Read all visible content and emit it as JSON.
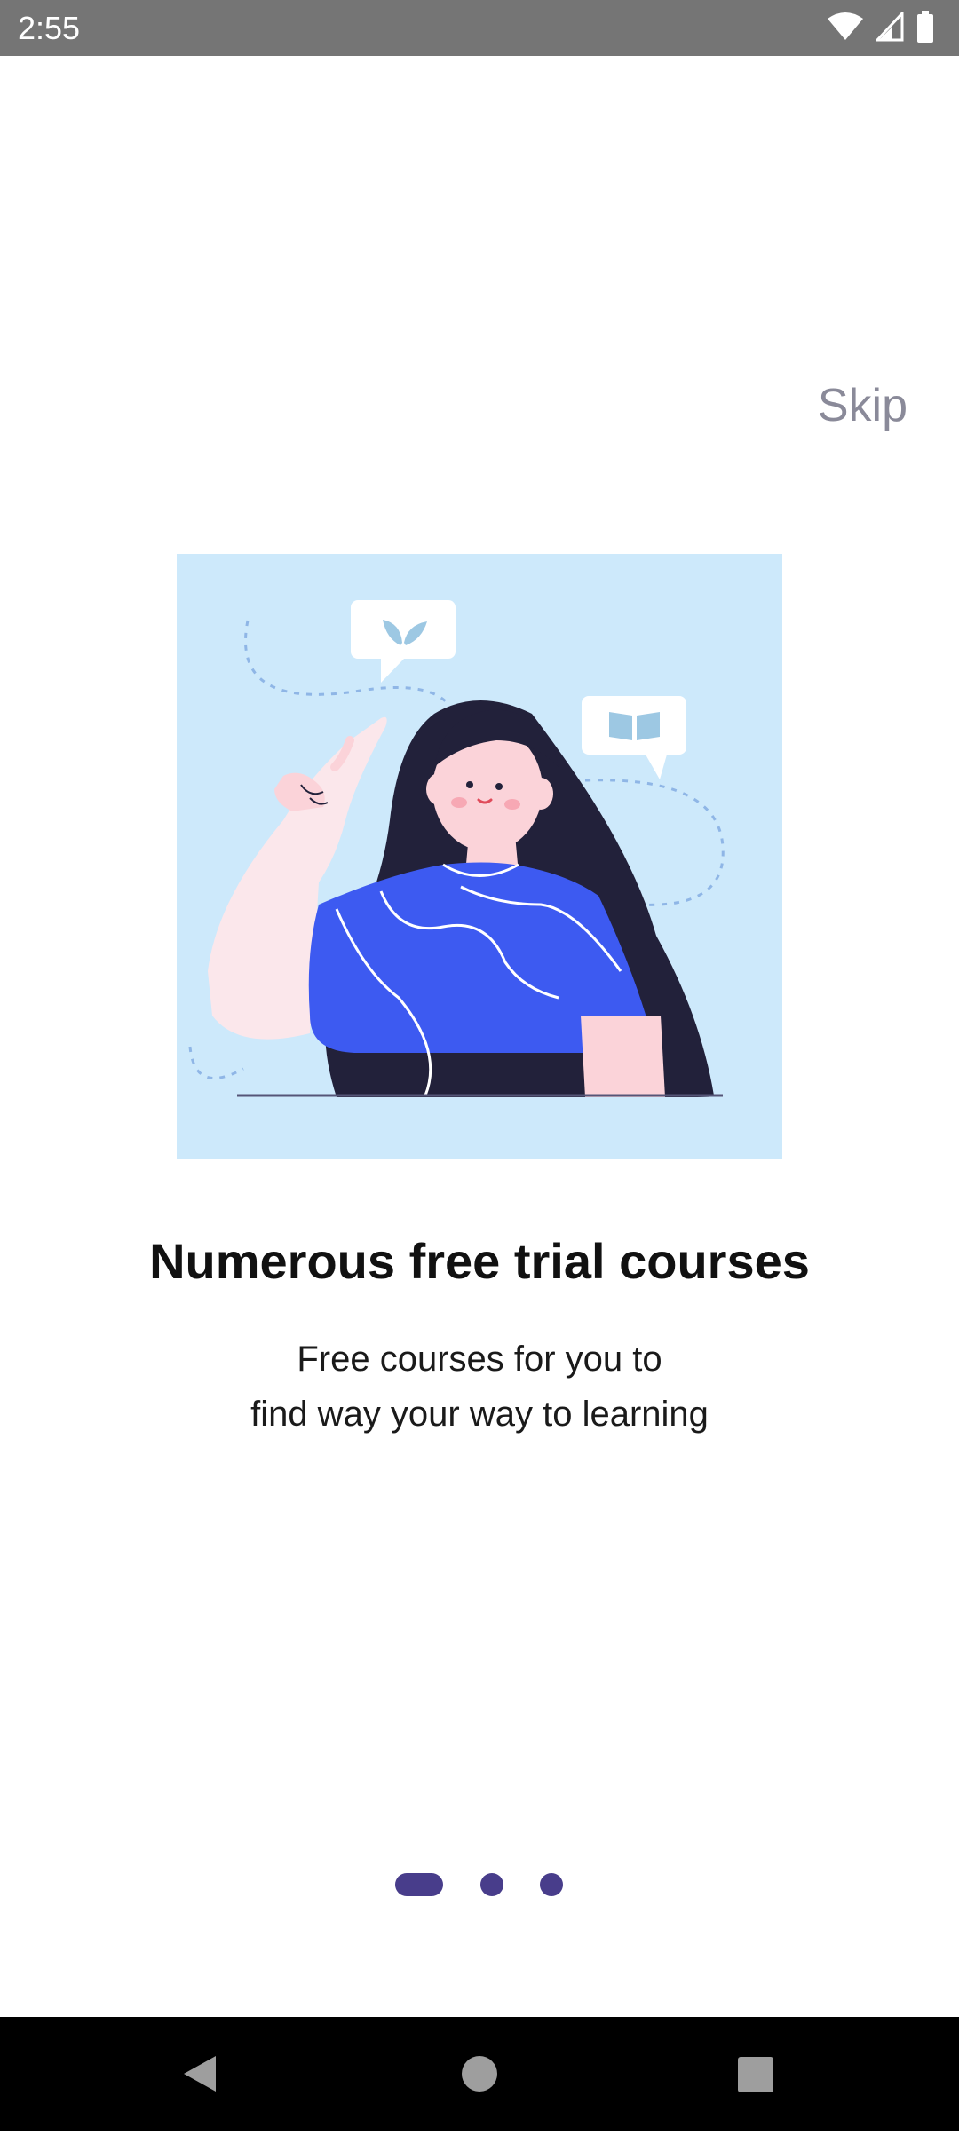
{
  "status_bar": {
    "time": "2:55",
    "icons": [
      "wifi-icon",
      "cellular-signal-icon",
      "battery-icon"
    ]
  },
  "onboarding": {
    "skip_label": "Skip",
    "illustration": "woman-pointing-up-with-speech-bubbles",
    "headline": "Numerous free trial courses",
    "subtitle_lines": [
      "Free courses for you to",
      "find way your way to learning"
    ],
    "page_indicator": {
      "total": 3,
      "current": 1
    }
  },
  "nav_bar": {
    "buttons": [
      "back-icon",
      "home-icon",
      "recents-icon"
    ]
  },
  "colors": {
    "accent": "#483d8b",
    "illustration_bg": "#cde9fb",
    "shirt": "#3d5af1",
    "hair": "#22213a",
    "skin": "#fbd3d9"
  }
}
